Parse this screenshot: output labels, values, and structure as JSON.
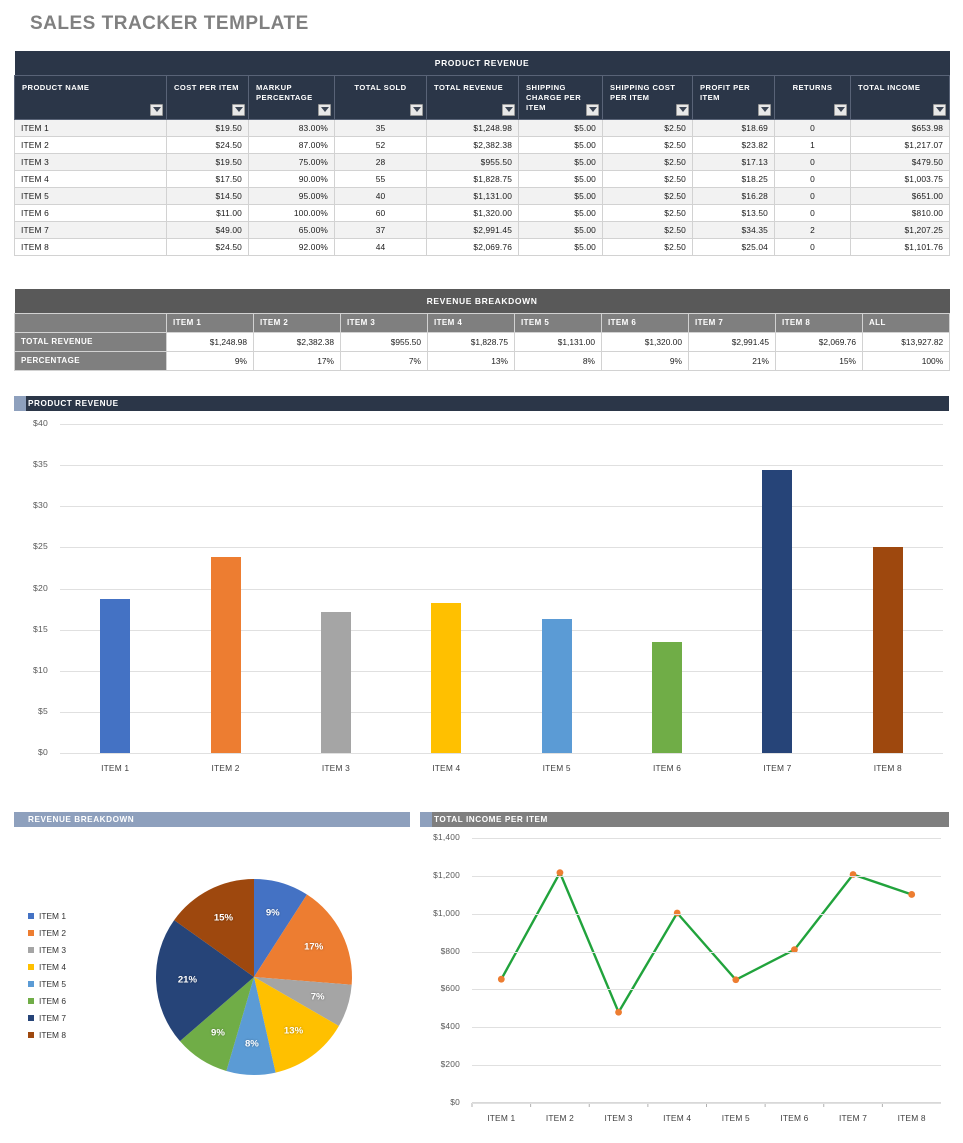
{
  "page": {
    "title": "SALES TRACKER TEMPLATE"
  },
  "product_revenue": {
    "band_title": "PRODUCT REVENUE",
    "columns": [
      "PRODUCT NAME",
      "COST PER ITEM",
      "MARKUP PERCENTAGE",
      "TOTAL SOLD",
      "TOTAL REVENUE",
      "SHIPPING CHARGE PER ITEM",
      "SHIPPING COST PER ITEM",
      "PROFIT PER ITEM",
      "RETURNS",
      "TOTAL INCOME"
    ],
    "rows": [
      {
        "name": "ITEM 1",
        "cost": "$19.50",
        "markup": "83.00%",
        "sold": "35",
        "revenue": "$1,248.98",
        "ship_charge": "$5.00",
        "ship_cost": "$2.50",
        "profit": "$18.69",
        "returns": "0",
        "income": "$653.98"
      },
      {
        "name": "ITEM 2",
        "cost": "$24.50",
        "markup": "87.00%",
        "sold": "52",
        "revenue": "$2,382.38",
        "ship_charge": "$5.00",
        "ship_cost": "$2.50",
        "profit": "$23.82",
        "returns": "1",
        "income": "$1,217.07"
      },
      {
        "name": "ITEM 3",
        "cost": "$19.50",
        "markup": "75.00%",
        "sold": "28",
        "revenue": "$955.50",
        "ship_charge": "$5.00",
        "ship_cost": "$2.50",
        "profit": "$17.13",
        "returns": "0",
        "income": "$479.50"
      },
      {
        "name": "ITEM 4",
        "cost": "$17.50",
        "markup": "90.00%",
        "sold": "55",
        "revenue": "$1,828.75",
        "ship_charge": "$5.00",
        "ship_cost": "$2.50",
        "profit": "$18.25",
        "returns": "0",
        "income": "$1,003.75"
      },
      {
        "name": "ITEM 5",
        "cost": "$14.50",
        "markup": "95.00%",
        "sold": "40",
        "revenue": "$1,131.00",
        "ship_charge": "$5.00",
        "ship_cost": "$2.50",
        "profit": "$16.28",
        "returns": "0",
        "income": "$651.00"
      },
      {
        "name": "ITEM 6",
        "cost": "$11.00",
        "markup": "100.00%",
        "sold": "60",
        "revenue": "$1,320.00",
        "ship_charge": "$5.00",
        "ship_cost": "$2.50",
        "profit": "$13.50",
        "returns": "0",
        "income": "$810.00"
      },
      {
        "name": "ITEM 7",
        "cost": "$49.00",
        "markup": "65.00%",
        "sold": "37",
        "revenue": "$2,991.45",
        "ship_charge": "$5.00",
        "ship_cost": "$2.50",
        "profit": "$34.35",
        "returns": "2",
        "income": "$1,207.25"
      },
      {
        "name": "ITEM 8",
        "cost": "$24.50",
        "markup": "92.00%",
        "sold": "44",
        "revenue": "$2,069.76",
        "ship_charge": "$5.00",
        "ship_cost": "$2.50",
        "profit": "$25.04",
        "returns": "0",
        "income": "$1,101.76"
      }
    ]
  },
  "revenue_breakdown": {
    "band_title": "REVENUE BREAKDOWN",
    "columns": [
      "ITEM 1",
      "ITEM 2",
      "ITEM 3",
      "ITEM 4",
      "ITEM 5",
      "ITEM 6",
      "ITEM 7",
      "ITEM 8",
      "ALL"
    ],
    "row_labels": [
      "TOTAL REVENUE",
      "PERCENTAGE"
    ],
    "total_revenue": [
      "$1,248.98",
      "$2,382.38",
      "$955.50",
      "$1,828.75",
      "$1,131.00",
      "$1,320.00",
      "$2,991.45",
      "$2,069.76",
      "$13,927.82"
    ],
    "percentage": [
      "9%",
      "17%",
      "7%",
      "13%",
      "8%",
      "9%",
      "21%",
      "15%",
      "100%"
    ]
  },
  "chart_data": [
    {
      "type": "bar",
      "title": "PRODUCT REVENUE",
      "categories": [
        "ITEM 1",
        "ITEM 2",
        "ITEM 3",
        "ITEM 4",
        "ITEM 5",
        "ITEM 6",
        "ITEM 7",
        "ITEM 8"
      ],
      "values": [
        18.69,
        23.82,
        17.13,
        18.25,
        16.28,
        13.5,
        34.35,
        25.04
      ],
      "colors": [
        "#4472c4",
        "#ed7d31",
        "#a5a5a5",
        "#ffc000",
        "#5b9bd5",
        "#70ad47",
        "#264478",
        "#9e480e"
      ],
      "ylim": [
        0,
        40
      ],
      "yticks": [
        "$0",
        "$5",
        "$10",
        "$15",
        "$20",
        "$25",
        "$30",
        "$35",
        "$40"
      ],
      "xlabel": "",
      "ylabel": "",
      "grid": true,
      "legend": "none"
    },
    {
      "type": "pie",
      "title": "REVENUE BREAKDOWN",
      "labels": [
        "ITEM 1",
        "ITEM 2",
        "ITEM 3",
        "ITEM 4",
        "ITEM 5",
        "ITEM 6",
        "ITEM 7",
        "ITEM 8"
      ],
      "values": [
        9,
        17,
        7,
        13,
        8,
        9,
        21,
        15
      ],
      "data_labels": [
        "9%",
        "17%",
        "7%",
        "13%",
        "8%",
        "9%",
        "21%",
        "15%"
      ],
      "colors": [
        "#4472c4",
        "#ed7d31",
        "#a5a5a5",
        "#ffc000",
        "#5b9bd5",
        "#70ad47",
        "#264478",
        "#9e480e"
      ],
      "legend": "left"
    },
    {
      "type": "line",
      "title": "TOTAL INCOME PER ITEM",
      "categories": [
        "ITEM 1",
        "ITEM 2",
        "ITEM 3",
        "ITEM 4",
        "ITEM 5",
        "ITEM 6",
        "ITEM 7",
        "ITEM 8"
      ],
      "values": [
        653.98,
        1217.07,
        479.5,
        1003.75,
        651.0,
        810.0,
        1207.25,
        1101.76
      ],
      "ylim": [
        0,
        1400
      ],
      "yticks": [
        "$0",
        "$200",
        "$400",
        "$600",
        "$800",
        "$1,000",
        "$1,200",
        "$1,400"
      ],
      "line_color": "#21a33c",
      "marker_color": "#ed7d31",
      "xlabel": "",
      "ylabel": "",
      "grid": true,
      "legend": "none"
    }
  ]
}
